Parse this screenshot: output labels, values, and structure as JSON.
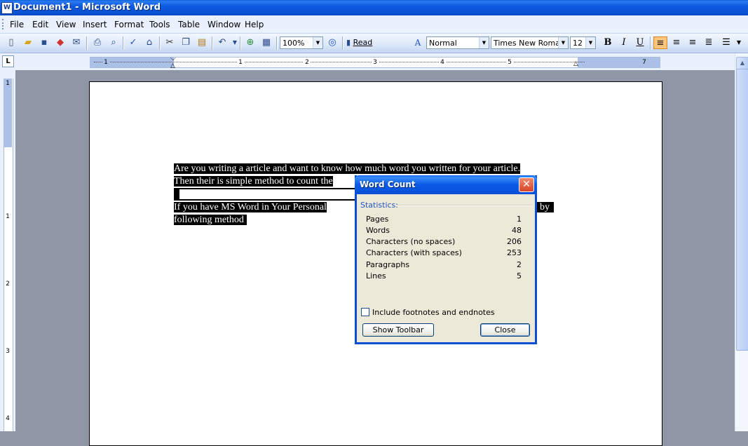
{
  "window": {
    "title": "Document1 - Microsoft Word"
  },
  "menu": [
    "File",
    "Edit",
    "View",
    "Insert",
    "Format",
    "Tools",
    "Table",
    "Window",
    "Help"
  ],
  "toolbar": {
    "zoom": "100%",
    "read_label": "Read",
    "style": "Normal",
    "font": "Times New Roman",
    "size": "12",
    "bold": "B",
    "italic": "I",
    "underline": "U"
  },
  "ruler": {
    "numbers": [
      "1",
      "1",
      "2",
      "3",
      "4",
      "5",
      "7"
    ],
    "vnumbers": [
      "1",
      "1",
      "2",
      "3",
      "4"
    ]
  },
  "document": {
    "line1": "Are you writing a article and want to know how much word you written for your article.",
    "line2": "Then their is simple method to count the",
    "line3a": "If you have MS Word in Your Personal",
    "line3b": "by",
    "line4": "following method"
  },
  "dialog": {
    "title": "Word Count",
    "statistics_label": "Statistics:",
    "stats": [
      {
        "name": "Pages",
        "value": "1"
      },
      {
        "name": "Words",
        "value": "48"
      },
      {
        "name": "Characters (no spaces)",
        "value": "206"
      },
      {
        "name": "Characters (with spaces)",
        "value": "253"
      },
      {
        "name": "Paragraphs",
        "value": "2"
      },
      {
        "name": "Lines",
        "value": "5"
      }
    ],
    "checkbox_label": "Include footnotes and endnotes",
    "show_toolbar": "Show Toolbar",
    "close": "Close"
  },
  "colors": {
    "titlebar": "#0a5fd8",
    "selection": "#000000",
    "menubar": "#eaf1fc",
    "dialog_bg": "#ece9d8"
  }
}
